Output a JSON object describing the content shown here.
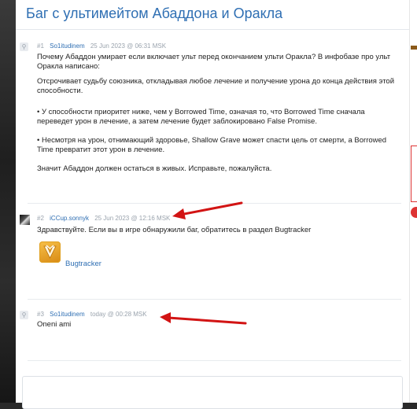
{
  "thread": {
    "title": "Баг с ультимейтом Абаддона и Оракла"
  },
  "posts": [
    {
      "num": "#1",
      "author": "So1itudinem",
      "date": "25 Jun 2023 @ 06:31 MSK",
      "paragraphs": [
        "Почему Абаддон умирает если включает ульт перед окончанием ульти Оракла? В инфобазе про ульт Оракла написано:",
        "Отсрочивает судьбу союзника, откладывая любое лечение и получение урона до конца действия этой способности.",
        "• У способности приоритет ниже, чем у Borrowed Time, означая то, что Borrowed Time сначала переведет урон в лечение, а затем лечение будет заблокировано False Promise.",
        "• Несмотря на урон, отнимающий здоровье, Shallow Grave может спасти цель от смерти, а Borrowed Time превратит этот урон в лечение.",
        "Значит Абаддон должен остаться в живых. Исправьте, пожалуйста."
      ]
    },
    {
      "num": "#2",
      "author": "iCCup.sonnyk",
      "date": "25 Jun 2023 @ 12:16 MSK",
      "paragraphs": [
        "Здравствуйте. Если вы в игре обнаружили баг, обратитесь в раздел Bugtracker"
      ],
      "link_label": "Bugtracker"
    },
    {
      "num": "#3",
      "author": "So1itudinem",
      "date": "today @ 00:28 MSK",
      "paragraphs": [
        "Oneni ami"
      ]
    }
  ],
  "colors": {
    "link": "#2f6fb3",
    "meta": "#9aa3ad",
    "arrow": "#d21414",
    "logo": "#e9a22a"
  }
}
